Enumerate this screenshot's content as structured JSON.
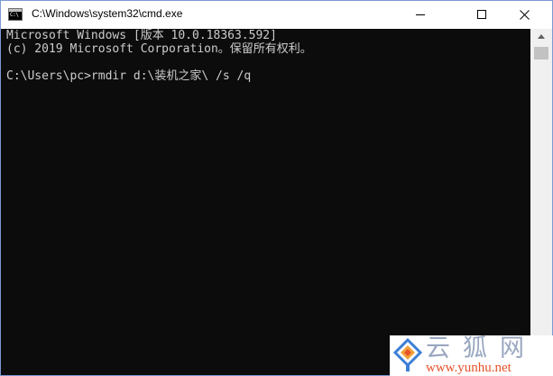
{
  "window": {
    "title": "C:\\Windows\\system32\\cmd.exe",
    "icon_text": "C:\\"
  },
  "console": {
    "lines": [
      "Microsoft Windows [版本 10.0.18363.592]",
      "(c) 2019 Microsoft Corporation。保留所有权利。",
      "",
      "C:\\Users\\pc>rmdir d:\\装机之家\\ /s /q"
    ]
  },
  "watermark": {
    "brand": "云狐网",
    "url": "www.yunhu.net"
  },
  "colors": {
    "console_bg": "#0c0c0c",
    "console_text": "#cccccc",
    "watermark_url": "#e8522a"
  }
}
